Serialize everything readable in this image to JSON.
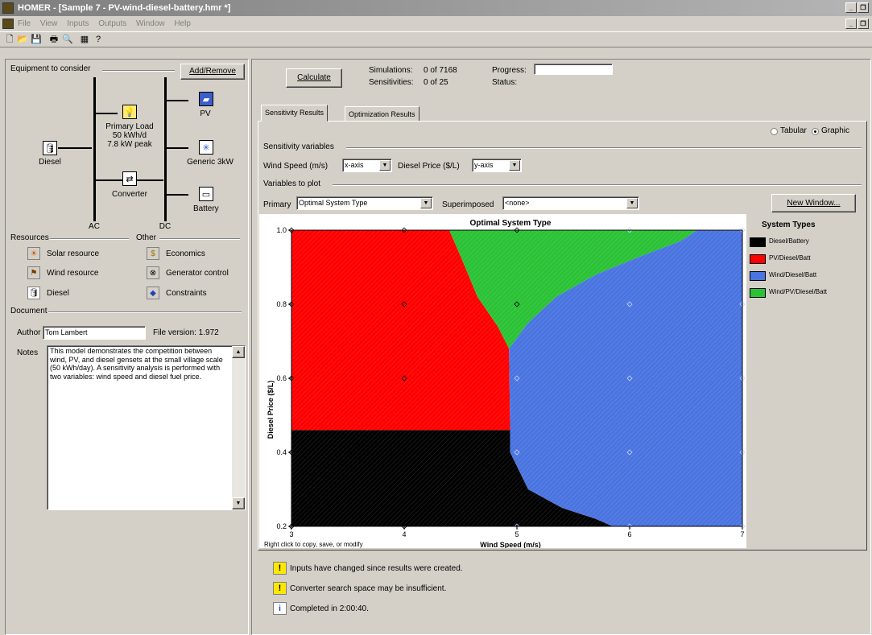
{
  "window": {
    "title": "HOMER - [Sample 7 - PV-wind-diesel-battery.hmr *]"
  },
  "menu": [
    "File",
    "View",
    "Inputs",
    "Outputs",
    "Window",
    "Help"
  ],
  "toolbar_icons": [
    "new-icon",
    "open-icon",
    "save-icon",
    "print-icon",
    "print-preview-icon",
    "table-icon",
    "help-icon"
  ],
  "equipment": {
    "title": "Equipment to consider",
    "add_remove": "Add/Remove",
    "primary_load": {
      "name": "Primary Load",
      "line1": "50 kWh/d",
      "line2": "7.8 kW peak"
    },
    "pv": "PV",
    "diesel": "Diesel",
    "generic": "Generic 3kW",
    "converter": "Converter",
    "battery": "Battery",
    "ac": "AC",
    "dc": "DC"
  },
  "resources": {
    "title": "Resources",
    "items": [
      "Solar resource",
      "Wind resource",
      "Diesel"
    ]
  },
  "other": {
    "title": "Other",
    "items": [
      "Economics",
      "Generator control",
      "Constraints"
    ]
  },
  "document": {
    "title": "Document",
    "author_label": "Author",
    "author": "Tom Lambert",
    "file_version": "File version: 1.972",
    "notes_label": "Notes",
    "notes": "This model demonstrates the competition between wind, PV, and diesel gensets at the small village scale (50 kWh/day).  A sensitivity analysis is performed with two variables: wind speed and diesel fuel price."
  },
  "calc": {
    "button": "Calculate",
    "simulations_label": "Simulations:",
    "simulations": "0 of 7168",
    "sensitivities_label": "Sensitivities:",
    "sensitivities": "0 of 25",
    "progress_label": "Progress:",
    "status_label": "Status:"
  },
  "tabs": [
    "Sensitivity Results",
    "Optimization Results"
  ],
  "view_mode": {
    "tabular": "Tabular",
    "graphic": "Graphic",
    "selected": "Graphic"
  },
  "sensitivity": {
    "title": "Sensitivity variables",
    "var1_label": "Wind Speed (m/s)",
    "var1_value": "x-axis",
    "var2_label": "Diesel Price ($/L)",
    "var2_value": "y-axis"
  },
  "plot_vars": {
    "title": "Variables to plot",
    "primary_label": "Primary",
    "primary_value": "Optimal System Type",
    "superimposed_label": "Superimposed",
    "superimposed_value": "<none>",
    "new_window": "New Window..."
  },
  "chart_footer": "Right click to copy, save, or modify",
  "legend": {
    "title": "System Types",
    "items": [
      {
        "label": "Diesel/Battery",
        "color": "#000000"
      },
      {
        "label": "PV/Diesel/Batt",
        "color": "#ff0000"
      },
      {
        "label": "Wind/Diesel/Batt",
        "color": "#4a74e0"
      },
      {
        "label": "Wind/PV/Diesel/Batt",
        "color": "#2bc236"
      }
    ]
  },
  "messages": [
    {
      "icon": "warning-icon",
      "text": "Inputs have changed since results were created."
    },
    {
      "icon": "warning-icon",
      "text": "Converter search space may be insufficient."
    },
    {
      "icon": "info-icon",
      "text": "Completed in 2:00:40."
    }
  ],
  "chart_data": {
    "type": "heatmap",
    "title": "Optimal System Type",
    "xlabel": "Wind Speed (m/s)",
    "ylabel": "Diesel Price ($/L)",
    "xlim": [
      3,
      7
    ],
    "ylim": [
      0.2,
      1.0
    ],
    "x_ticks": [
      "3",
      "4",
      "5",
      "6",
      "7"
    ],
    "y_ticks": [
      "0.2",
      "0.4",
      "0.6",
      "0.8",
      "1.0"
    ],
    "sensitivity_points": {
      "x": [
        3,
        4,
        5,
        6,
        7
      ],
      "y": [
        0.2,
        0.4,
        0.6,
        0.8,
        1.0
      ]
    },
    "regions": [
      {
        "name": "Diesel/Battery",
        "color": "#000000",
        "polygon": [
          [
            3,
            0.2
          ],
          [
            3,
            0.46
          ],
          [
            4.94,
            0.46
          ],
          [
            4.94,
            0.4
          ],
          [
            5.1,
            0.3
          ],
          [
            5.4,
            0.25
          ],
          [
            5.7,
            0.22
          ],
          [
            5.85,
            0.2
          ]
        ]
      },
      {
        "name": "PV/Diesel/Batt",
        "color": "#ff0000",
        "polygon": [
          [
            3,
            0.46
          ],
          [
            3,
            1.0
          ],
          [
            4.4,
            1.0
          ],
          [
            4.5,
            0.93
          ],
          [
            4.65,
            0.82
          ],
          [
            4.83,
            0.74
          ],
          [
            4.93,
            0.68
          ],
          [
            4.94,
            0.46
          ]
        ]
      },
      {
        "name": "Wind/PV/Diesel/Batt",
        "color": "#2bc236",
        "polygon": [
          [
            4.4,
            1.0
          ],
          [
            6.6,
            1.0
          ],
          [
            6.45,
            0.97
          ],
          [
            6.1,
            0.93
          ],
          [
            5.7,
            0.88
          ],
          [
            5.35,
            0.82
          ],
          [
            5.1,
            0.75
          ],
          [
            4.93,
            0.68
          ],
          [
            4.83,
            0.74
          ],
          [
            4.65,
            0.82
          ],
          [
            4.5,
            0.93
          ]
        ]
      },
      {
        "name": "Wind/Diesel/Batt",
        "color": "#4a74e0",
        "polygon": [
          [
            6.6,
            1.0
          ],
          [
            7,
            1.0
          ],
          [
            7,
            0.2
          ],
          [
            5.85,
            0.2
          ],
          [
            5.7,
            0.22
          ],
          [
            5.4,
            0.25
          ],
          [
            5.1,
            0.3
          ],
          [
            4.94,
            0.4
          ],
          [
            4.94,
            0.46
          ],
          [
            4.93,
            0.68
          ],
          [
            5.1,
            0.75
          ],
          [
            5.35,
            0.82
          ],
          [
            5.7,
            0.88
          ],
          [
            6.1,
            0.93
          ],
          [
            6.45,
            0.97
          ]
        ]
      }
    ]
  }
}
